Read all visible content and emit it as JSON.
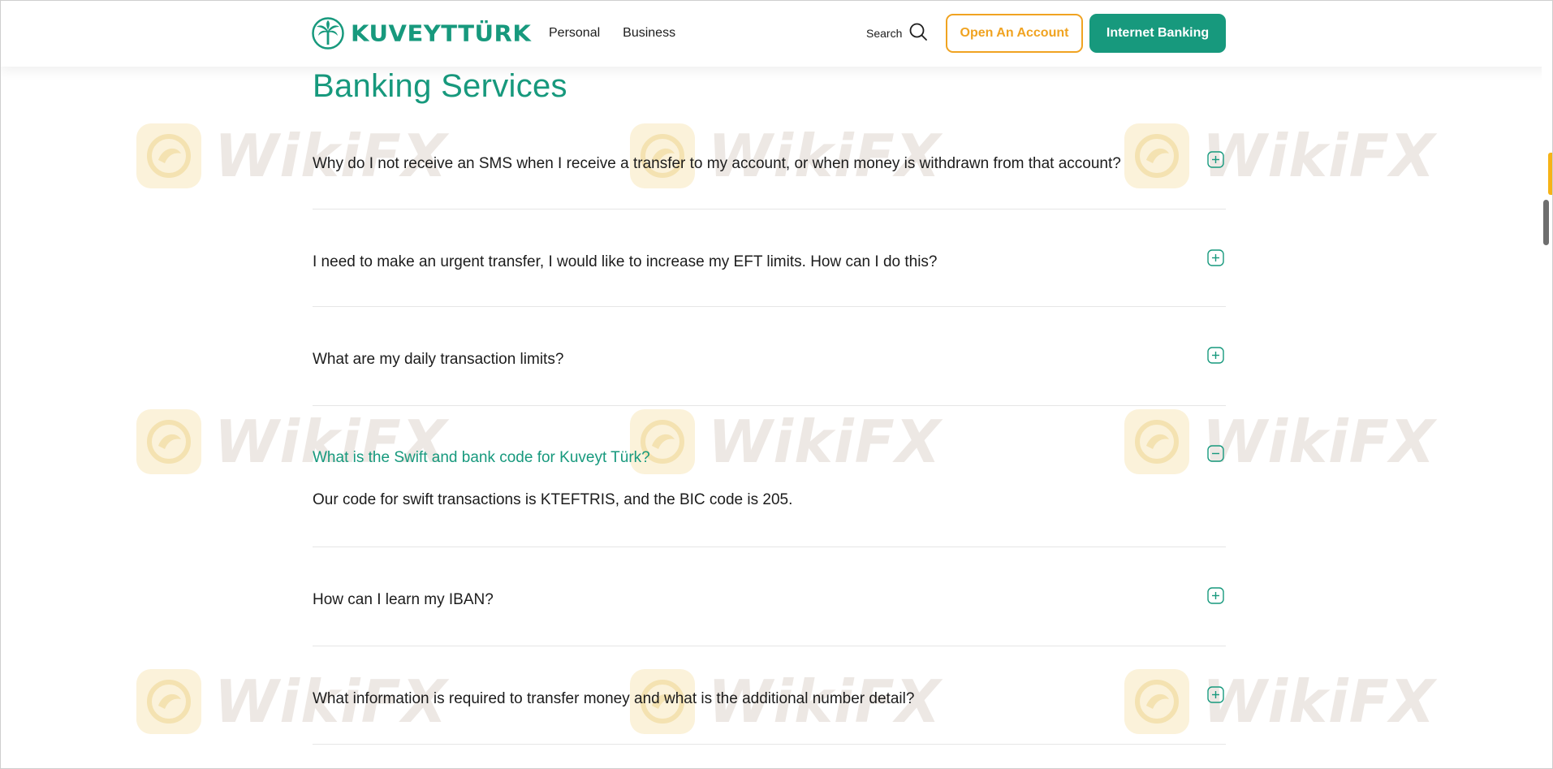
{
  "header": {
    "logo_text": "KUVEYTTÜRK",
    "nav": [
      {
        "label": "Personal"
      },
      {
        "label": "Business"
      }
    ],
    "search_label": "Search",
    "open_account_label": "Open An Account",
    "internet_banking_label": "Internet Banking"
  },
  "main": {
    "title": "Banking Services",
    "faqs": [
      {
        "question": "Why do I not receive an SMS when I receive a transfer to my account, or when money is withdrawn from that account?",
        "expanded": false
      },
      {
        "question": "I need to make an urgent transfer, I would like to increase my EFT limits. How can I do this?",
        "expanded": false
      },
      {
        "question": "What are my daily transaction limits?",
        "expanded": false
      },
      {
        "question": "What is the Swift and bank code for Kuveyt Türk?",
        "expanded": true,
        "answer": "Our code for swift transactions is KTEFTRIS, and the BIC code is 205."
      },
      {
        "question": "How can I learn my IBAN?",
        "expanded": false
      },
      {
        "question": "What information is required to transfer money and what is the additional number detail?",
        "expanded": false
      }
    ]
  },
  "watermark_text": "WikiFX",
  "colors": {
    "brand_green": "#17997d",
    "accent_orange": "#f0a321",
    "watermark_gold": "#fbf1d6"
  },
  "icons": {
    "logo": "palm-tree-icon",
    "search": "search-icon",
    "collapsed": "plus-square-icon",
    "expanded": "minus-square-icon"
  }
}
